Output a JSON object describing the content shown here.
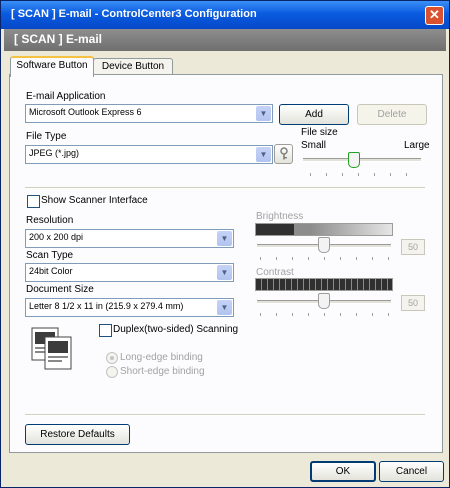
{
  "window": {
    "title": "[ SCAN ]   E-mail - ControlCenter3 Configuration",
    "close_glyph": "✕"
  },
  "banner": {
    "text": "[ SCAN ]   E-mail"
  },
  "tabs": [
    {
      "label": "Software Button",
      "active": true
    },
    {
      "label": "Device Button",
      "active": false
    }
  ],
  "email_app": {
    "label": "E-mail Application",
    "value": "Microsoft Outlook Express 6",
    "add": "Add",
    "delete": "Delete"
  },
  "file_type": {
    "label": "File Type",
    "value": "JPEG (*.jpg)"
  },
  "file_size": {
    "label": "File size",
    "small": "Small",
    "large": "Large",
    "level": 0.42
  },
  "show_scanner": {
    "label": "Show Scanner Interface",
    "checked": false
  },
  "resolution": {
    "label": "Resolution",
    "value": "200 x 200 dpi"
  },
  "scan_type": {
    "label": "Scan Type",
    "value": "24bit Color"
  },
  "document_size": {
    "label": "Document Size",
    "value": "Letter 8 1/2 x 11 in (215.9 x 279.4 mm)"
  },
  "brightness": {
    "label": "Brightness",
    "value": "50"
  },
  "contrast": {
    "label": "Contrast",
    "value": "50"
  },
  "duplex": {
    "label": "Duplex(two-sided) Scanning",
    "checked": false,
    "options": [
      "Long-edge binding",
      "Short-edge binding"
    ],
    "selected": 0
  },
  "restore": "Restore Defaults",
  "footer": {
    "ok": "OK",
    "cancel": "Cancel"
  },
  "icons": {
    "combo_arrow": "▼"
  }
}
